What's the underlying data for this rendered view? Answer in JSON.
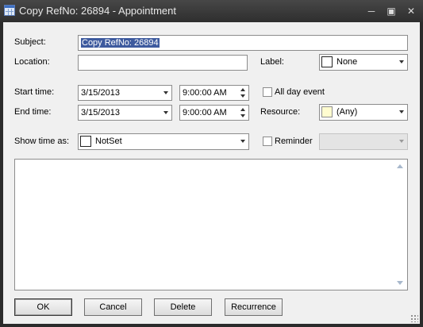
{
  "window": {
    "title": "Copy RefNo: 26894 - Appointment"
  },
  "labels": {
    "subject": "Subject:",
    "location": "Location:",
    "label": "Label:",
    "start_time": "Start time:",
    "end_time": "End time:",
    "all_day": "All day event",
    "resource": "Resource:",
    "show_time_as": "Show time as:",
    "reminder": "Reminder"
  },
  "fields": {
    "subject": "Copy RefNo: 26894",
    "location": "",
    "label_value": "None",
    "start_date": "3/15/2013",
    "start_time": "9:00:00 AM",
    "end_date": "3/15/2013",
    "end_time": "9:00:00 AM",
    "resource_value": "(Any)",
    "show_time_as_value": "NotSet",
    "reminder_value": ""
  },
  "checks": {
    "all_day": false,
    "reminder": false
  },
  "colors": {
    "label_swatch": "#ffffff",
    "resource_swatch": "#fffcd0",
    "show_time_swatch": "#ffffff"
  },
  "buttons": {
    "ok": "OK",
    "cancel": "Cancel",
    "delete": "Delete",
    "recurrence": "Recurrence"
  },
  "icons": {
    "app": "calendar-icon",
    "minimize": "minimize-icon",
    "maximize": "maximize-icon",
    "close": "close-icon"
  }
}
